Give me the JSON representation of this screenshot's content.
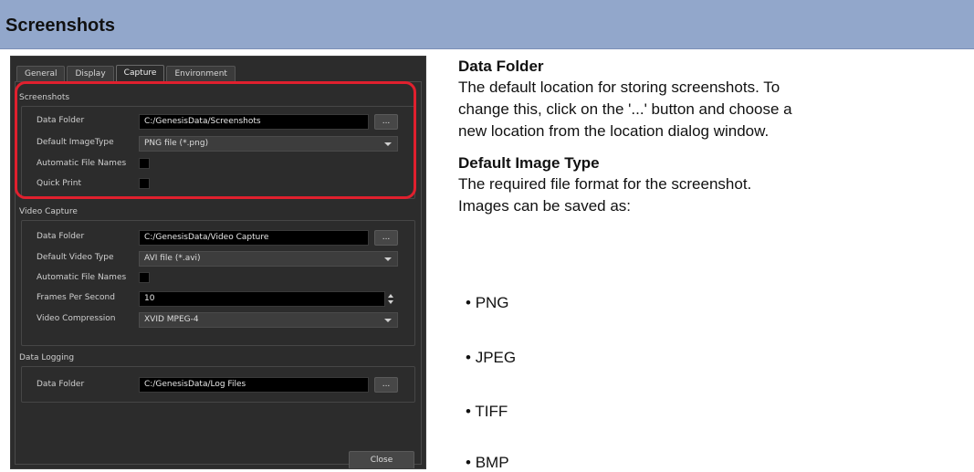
{
  "header": {
    "title": "Screenshots"
  },
  "dialog": {
    "tabs": [
      "General",
      "Display",
      "Capture",
      "Environment"
    ],
    "active_tab": "Capture",
    "screenshots": {
      "title": "Screenshots",
      "data_folder_label": "Data Folder",
      "data_folder_value": "C:/GenesisData/Screenshots",
      "image_type_label": "Default ImageType",
      "image_type_value": "PNG file (*.png)",
      "auto_names_label": "Automatic File Names",
      "quick_print_label": "Quick Print"
    },
    "video": {
      "title": "Video Capture",
      "data_folder_label": "Data Folder",
      "data_folder_value": "C:/GenesisData/Video Capture",
      "video_type_label": "Default Video Type",
      "video_type_value": "AVI file (*.avi)",
      "auto_names_label": "Automatic File Names",
      "fps_label": "Frames Per Second",
      "fps_value": "10",
      "compression_label": "Video Compression",
      "compression_value": "XVID MPEG-4"
    },
    "logging": {
      "title": "Data Logging",
      "data_folder_label": "Data Folder",
      "data_folder_value": "C:/GenesisData/Log Files"
    },
    "browse_label": "...",
    "close_label": "Close"
  },
  "doc": {
    "heading1": "Data Folder",
    "para1": [
      "The default location for storing screenshots. To",
      "change this, click on the '...' button and choose a",
      "new location from the location dialog window."
    ],
    "heading2": "Default Image Type",
    "para2": [
      "The required file format for the screenshot.",
      "Images can be saved as:"
    ],
    "bullets": [
      "PNG",
      "JPEG",
      "TIFF",
      "BMP"
    ]
  },
  "colors": {
    "header_bg": "#92a7cb",
    "dialog_bg": "#2c2c2c",
    "highlight": "#e0202e"
  }
}
